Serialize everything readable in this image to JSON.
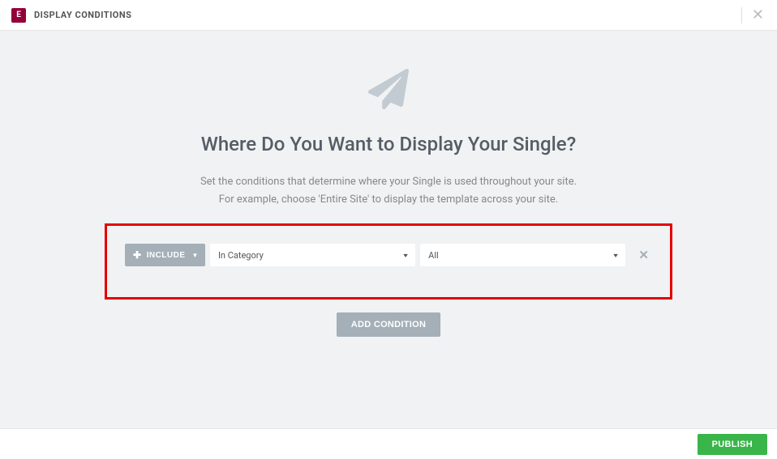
{
  "header": {
    "logo_text": "E",
    "title": "DISPLAY CONDITIONS"
  },
  "main": {
    "title": "Where Do You Want to Display Your Single?",
    "desc_line1": "Set the conditions that determine where your Single is used throughout your site.",
    "desc_line2": "For example, choose 'Entire Site' to display the template across your site."
  },
  "condition": {
    "include_label": "INCLUDE",
    "select1": "In Category",
    "select2": "All"
  },
  "buttons": {
    "add_condition": "ADD CONDITION",
    "publish": "PUBLISH"
  }
}
